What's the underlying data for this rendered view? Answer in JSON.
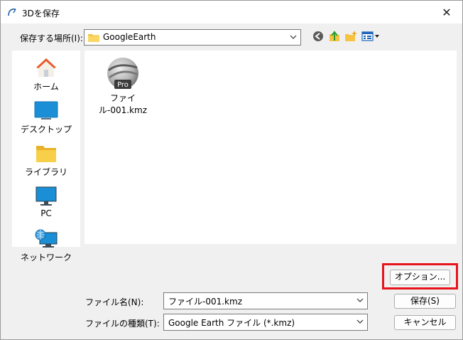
{
  "window": {
    "title": "3Dを保存"
  },
  "location": {
    "label": "保存する場所(I):",
    "value": "GoogleEarth"
  },
  "toolbar": {
    "icons": [
      "back-icon",
      "up-folder-icon",
      "new-folder-icon",
      "view-menu-icon"
    ]
  },
  "places": [
    {
      "label": "ホーム",
      "icon": "home-icon"
    },
    {
      "label": "デスクトップ",
      "icon": "desktop-icon"
    },
    {
      "label": "ライブラリ",
      "icon": "library-icon"
    },
    {
      "label": "PC",
      "icon": "pc-icon"
    },
    {
      "label": "ネットワーク",
      "icon": "network-icon"
    }
  ],
  "files": [
    {
      "name": "ファイル-001.kmz",
      "badge": "Pro",
      "icon": "google-earth-pro-icon"
    }
  ],
  "buttons": {
    "options": "オプション...",
    "save": "保存(S)",
    "cancel": "キャンセル"
  },
  "filename": {
    "label": "ファイル名(N):",
    "value": "ファイル-001.kmz"
  },
  "filetype": {
    "label": "ファイルの種類(T):",
    "value": "Google Earth ファイル (*.kmz)"
  },
  "colors": {
    "highlight": "#e8141c",
    "folder": "#f6c342",
    "window_bg": "#f0f0f0"
  }
}
